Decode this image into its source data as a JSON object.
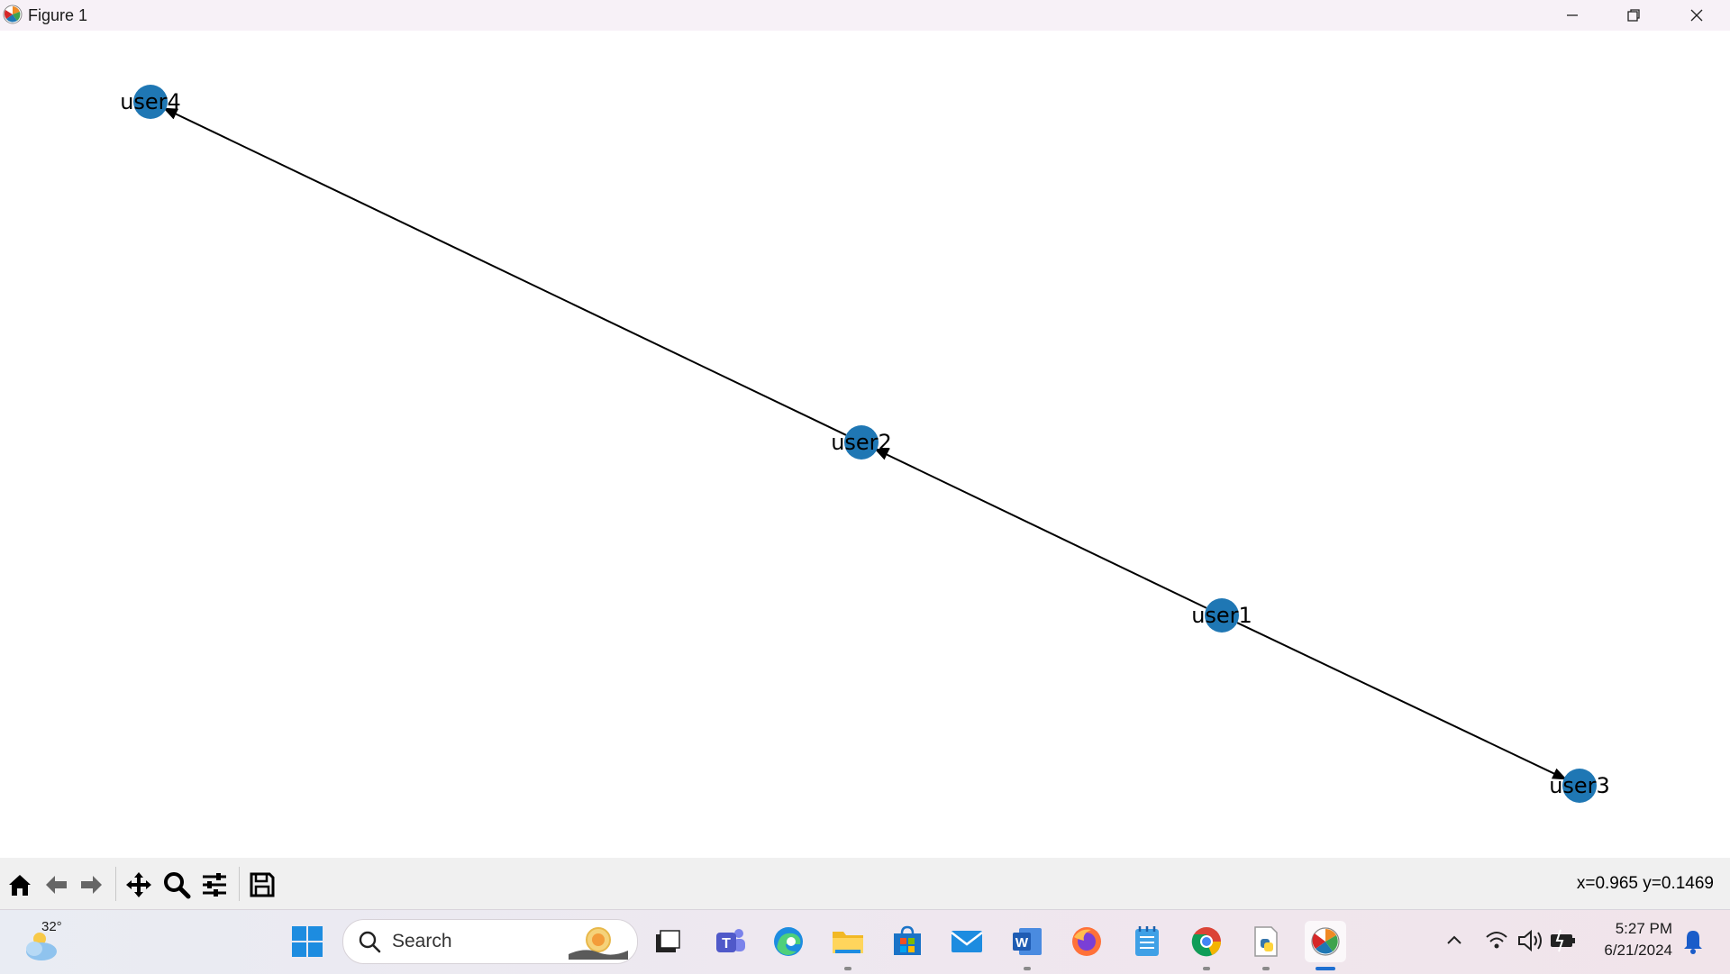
{
  "window": {
    "title": "Figure 1"
  },
  "graph": {
    "nodes": [
      {
        "id": "user4",
        "label": "user4"
      },
      {
        "id": "user2",
        "label": "user2"
      },
      {
        "id": "user1",
        "label": "user1"
      },
      {
        "id": "user3",
        "label": "user3"
      }
    ],
    "edges": [
      {
        "from": "user2",
        "to": "user4"
      },
      {
        "from": "user1",
        "to": "user2"
      },
      {
        "from": "user1",
        "to": "user3"
      }
    ],
    "node_color": "#1f77b4",
    "edge_color": "#000000"
  },
  "toolbar": {
    "tools": [
      "home-icon",
      "back-arrow-icon",
      "forward-arrow-icon",
      "pan-icon",
      "zoom-icon",
      "configure-subplots-icon",
      "save-icon"
    ],
    "coords": "x=0.965 y=0.1469"
  },
  "taskbar": {
    "weather_temp": "32°",
    "search_placeholder": "Search",
    "apps": [
      "windows-start-icon",
      "task-view-icon",
      "teams-icon",
      "edge-icon",
      "file-explorer-icon",
      "microsoft-store-icon",
      "mail-icon",
      "word-icon",
      "firefox-icon",
      "notepad-icon",
      "chrome-icon",
      "python-file-icon",
      "matplotlib-figure-icon"
    ],
    "time": "5:27 PM",
    "date": "6/21/2024"
  }
}
